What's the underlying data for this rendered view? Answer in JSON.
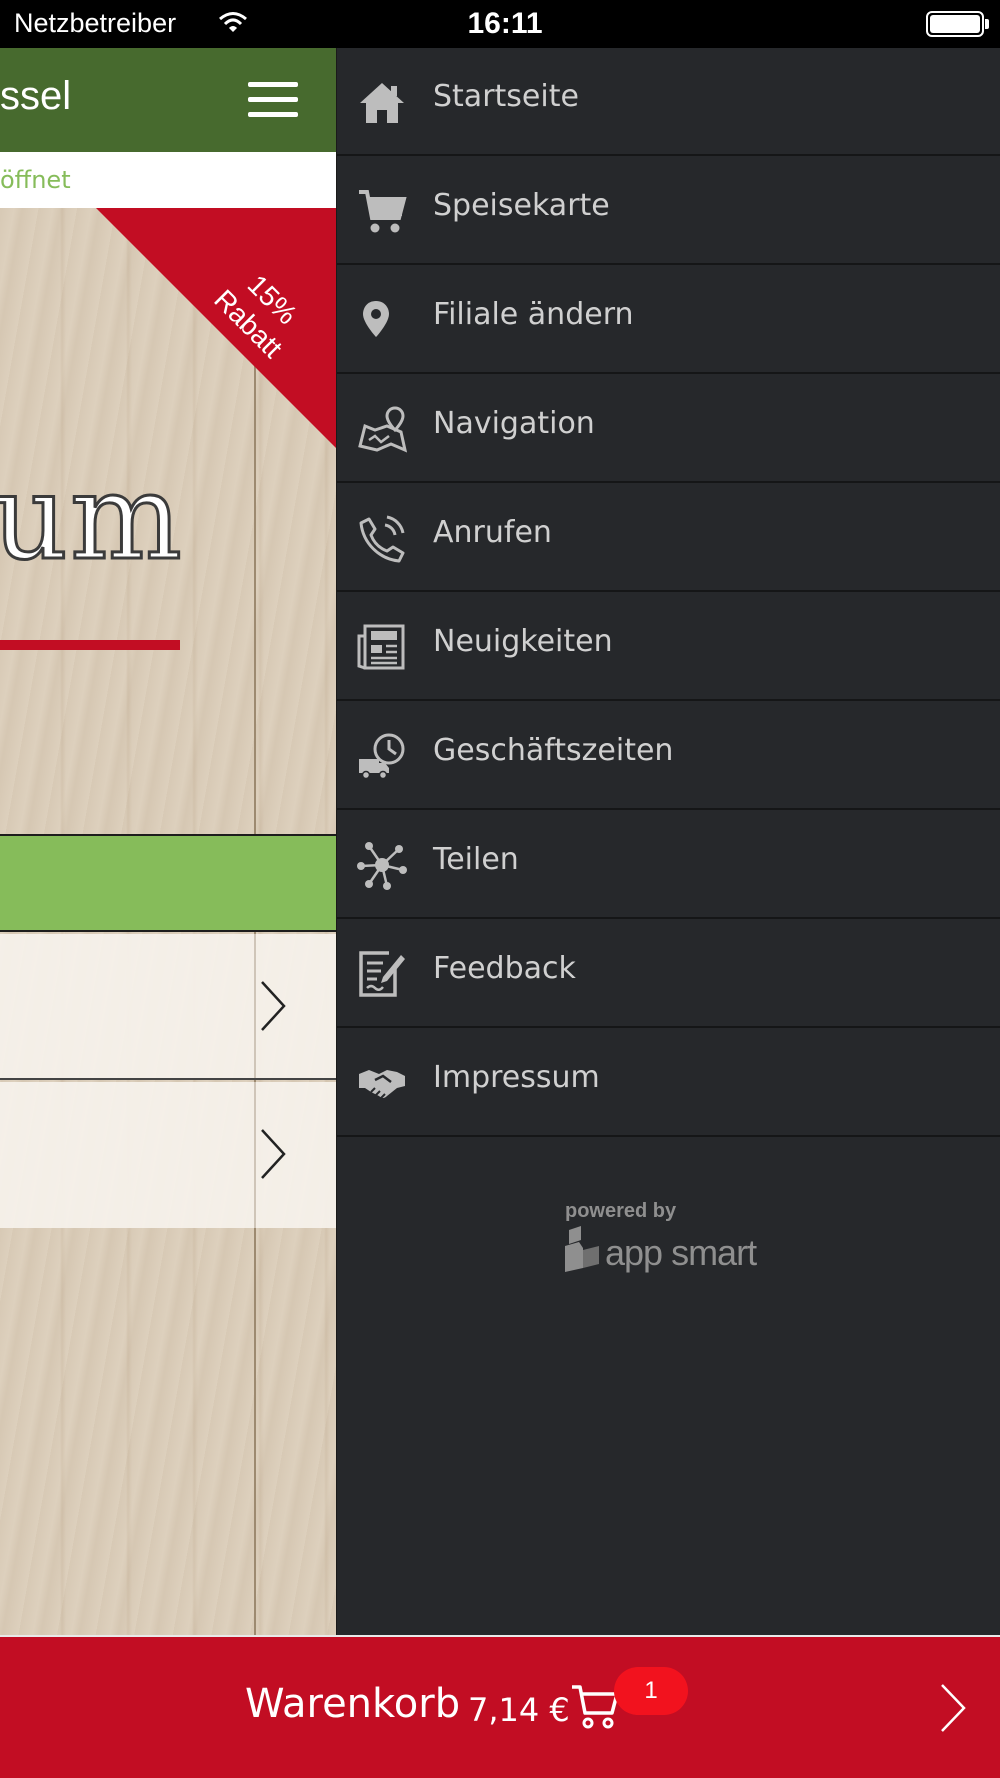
{
  "status_bar": {
    "carrier": "Netzbetreiber",
    "time": "16:11"
  },
  "left_app": {
    "title": "ssel",
    "open_status": "öffnet",
    "discount_line1": "15%",
    "discount_line2": "Rabatt",
    "logo_fragment": "um",
    "colors": {
      "header": "#476a2e",
      "accent_green": "#86bc5a",
      "accent_red": "#c20d23"
    }
  },
  "menu": {
    "items": [
      {
        "label": "Startseite",
        "icon": "home-icon"
      },
      {
        "label": "Speisekarte",
        "icon": "cart-icon"
      },
      {
        "label": "Filiale ändern",
        "icon": "location-pin-icon"
      },
      {
        "label": "Navigation",
        "icon": "map-icon"
      },
      {
        "label": "Anrufen",
        "icon": "phone-icon"
      },
      {
        "label": "Neuigkeiten",
        "icon": "newspaper-icon"
      },
      {
        "label": "Geschäftszeiten",
        "icon": "delivery-clock-icon"
      },
      {
        "label": "Teilen",
        "icon": "share-icon"
      },
      {
        "label": "Feedback",
        "icon": "feedback-icon"
      },
      {
        "label": "Impressum",
        "icon": "handshake-icon"
      }
    ],
    "powered_by": "powered by",
    "brand": "app smart"
  },
  "cart": {
    "label": "Warenkorb",
    "price": "7,14 €",
    "count": "1"
  }
}
